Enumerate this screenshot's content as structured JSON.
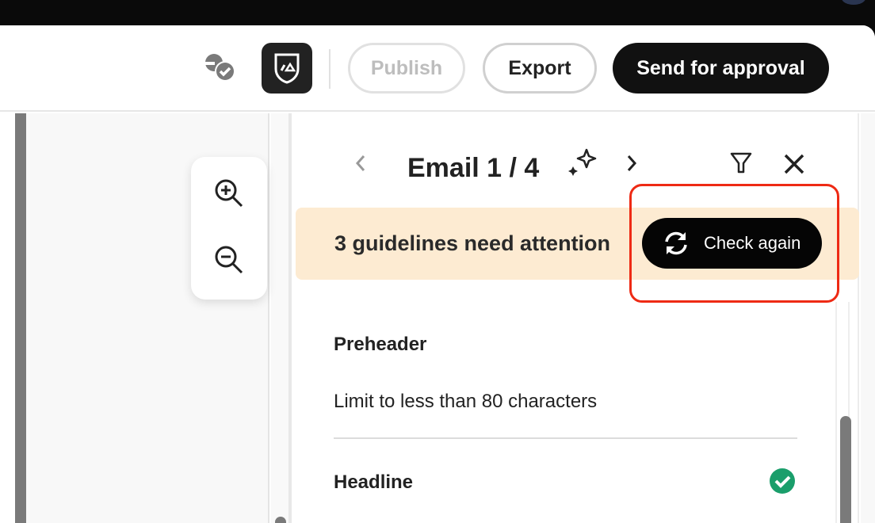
{
  "header": {
    "publish_label": "Publish",
    "export_label": "Export",
    "send_label": "Send for approval",
    "icons": [
      "approvals-icon",
      "brand-shield-icon"
    ]
  },
  "canvas": {
    "icons": [
      "zoom-in-icon",
      "zoom-out-icon"
    ]
  },
  "panel": {
    "title": "Email 1 / 4",
    "icons": [
      "chevron-left-icon",
      "sparkle-icon",
      "chevron-right-icon",
      "filter-icon",
      "close-icon"
    ],
    "banner": {
      "text": "3 guidelines need attention",
      "button_label": "Check again",
      "color": "#fdebd2"
    },
    "guidelines": [
      {
        "name": "Preheader",
        "description": "Limit to less than 80 characters"
      },
      {
        "name": "Headline",
        "status": "passed",
        "status_color": "#1a9e6b"
      }
    ]
  },
  "highlight_color": "#ee2a14"
}
